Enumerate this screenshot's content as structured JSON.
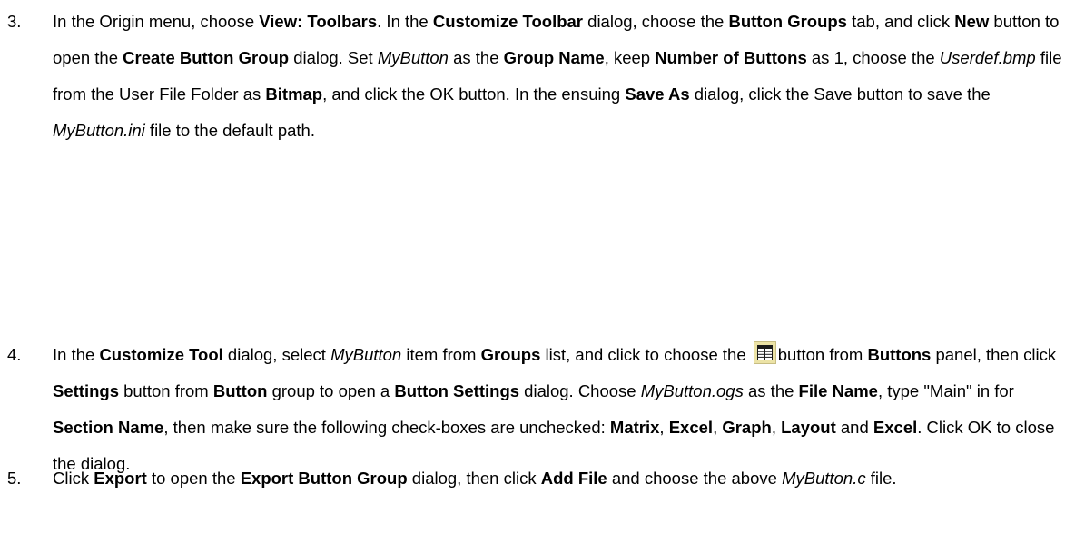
{
  "steps": [
    {
      "number": "3.",
      "segments": [
        {
          "t": "In the Origin menu, choose ",
          "s": "n"
        },
        {
          "t": "View: Toolbars",
          "s": "b"
        },
        {
          "t": ". In the ",
          "s": "n"
        },
        {
          "t": "Customize Toolbar",
          "s": "b"
        },
        {
          "t": " dialog, choose the ",
          "s": "n"
        },
        {
          "t": "Button Groups",
          "s": "b"
        },
        {
          "t": " tab, and click ",
          "s": "n"
        },
        {
          "t": "New",
          "s": "b"
        },
        {
          "t": " button to open the ",
          "s": "n"
        },
        {
          "t": "Create Button Group",
          "s": "b"
        },
        {
          "t": " dialog. Set ",
          "s": "n"
        },
        {
          "t": "MyButton",
          "s": "i"
        },
        {
          "t": " as the ",
          "s": "n"
        },
        {
          "t": "Group Name",
          "s": "b"
        },
        {
          "t": ", keep ",
          "s": "n"
        },
        {
          "t": "Number of Buttons",
          "s": "b"
        },
        {
          "t": " as 1, choose the ",
          "s": "n"
        },
        {
          "t": "Userdef.bmp",
          "s": "i"
        },
        {
          "t": " file from the User File Folder as ",
          "s": "n"
        },
        {
          "t": "Bitmap",
          "s": "b"
        },
        {
          "t": ", and click the OK button. In the ensuing ",
          "s": "n"
        },
        {
          "t": "Save As",
          "s": "b"
        },
        {
          "t": " dialog, click the Save button to save the ",
          "s": "n"
        },
        {
          "t": "MyButton.ini",
          "s": "i"
        },
        {
          "t": " file to the default path.",
          "s": "n"
        }
      ]
    },
    {
      "number": "4.",
      "segments": [
        {
          "t": "In the ",
          "s": "n"
        },
        {
          "t": "Customize Tool",
          "s": "b"
        },
        {
          "t": " dialog, select ",
          "s": "n"
        },
        {
          "t": "MyButton",
          "s": "i"
        },
        {
          "t": " item from ",
          "s": "n"
        },
        {
          "t": "Groups",
          "s": "b"
        },
        {
          "t": " list, and click to choose the ",
          "s": "n"
        },
        {
          "t": "",
          "s": "icon",
          "icon": "button-grid-icon"
        },
        {
          "t": "button from ",
          "s": "n"
        },
        {
          "t": "Buttons",
          "s": "b"
        },
        {
          "t": " panel, then click ",
          "s": "n"
        },
        {
          "t": "Settings",
          "s": "b"
        },
        {
          "t": " button from ",
          "s": "n"
        },
        {
          "t": "Button",
          "s": "b"
        },
        {
          "t": " group to open a ",
          "s": "n"
        },
        {
          "t": "Button Settings",
          "s": "b"
        },
        {
          "t": " dialog. Choose ",
          "s": "n"
        },
        {
          "t": "MyButton.ogs",
          "s": "i"
        },
        {
          "t": " as the ",
          "s": "n"
        },
        {
          "t": "File Name",
          "s": "b"
        },
        {
          "t": ", type \"Main\" in for ",
          "s": "n"
        },
        {
          "t": "Section Name",
          "s": "b"
        },
        {
          "t": ", then make sure the following check-boxes are unchecked: ",
          "s": "n"
        },
        {
          "t": "Matrix",
          "s": "b"
        },
        {
          "t": ", ",
          "s": "n"
        },
        {
          "t": "Excel",
          "s": "b"
        },
        {
          "t": ", ",
          "s": "n"
        },
        {
          "t": "Graph",
          "s": "b"
        },
        {
          "t": ", ",
          "s": "n"
        },
        {
          "t": "Layout",
          "s": "b"
        },
        {
          "t": " and ",
          "s": "n"
        },
        {
          "t": "Excel",
          "s": "b"
        },
        {
          "t": ". Click OK to close the dialog.",
          "s": "n"
        }
      ]
    },
    {
      "number": "5.",
      "segments": [
        {
          "t": "Click ",
          "s": "n"
        },
        {
          "t": "Export",
          "s": "b"
        },
        {
          "t": " to open the ",
          "s": "n"
        },
        {
          "t": "Export Button Group",
          "s": "b"
        },
        {
          "t": " dialog, then click ",
          "s": "n"
        },
        {
          "t": "Add File",
          "s": "b"
        },
        {
          "t": " and choose the above ",
          "s": "n"
        },
        {
          "t": "MyButton.c",
          "s": "i"
        },
        {
          "t": " file.",
          "s": "n"
        }
      ]
    }
  ]
}
